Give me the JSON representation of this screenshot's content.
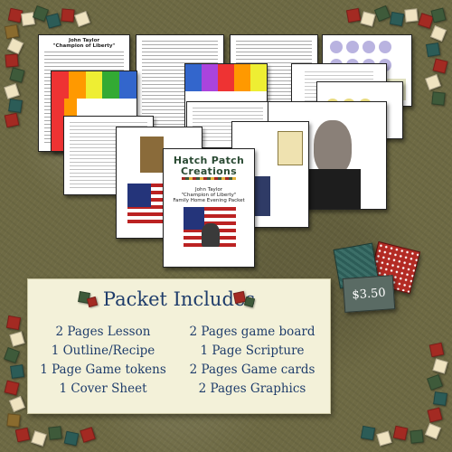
{
  "cover": {
    "brand_line1": "Hatch Patch",
    "brand_line2": "Creations",
    "subject": "John Taylor",
    "subject_tagline": "\"Champion of Liberty\"",
    "product": "Family Home Evening Packet"
  },
  "lesson_doc": {
    "heading1": "John Taylor",
    "heading2": "\"Champion of Liberty\""
  },
  "panel": {
    "title": "Packet Includes",
    "left_items": [
      "2 Pages Lesson",
      "1 Outline/Recipe",
      "1 Page Game tokens",
      "1 Cover Sheet"
    ],
    "right_items": [
      "2 Pages game board",
      "1 Page Scripture",
      "2 Pages Game cards",
      "2 Pages Graphics"
    ]
  },
  "price": "$3.50",
  "colors": {
    "background": "#6e6a44",
    "panel": "#f3f1d9",
    "panel_text": "#1f3d6b",
    "quilt_red": "#a32a22",
    "quilt_green": "#3e5a3a",
    "quilt_teal": "#2c5c57"
  }
}
